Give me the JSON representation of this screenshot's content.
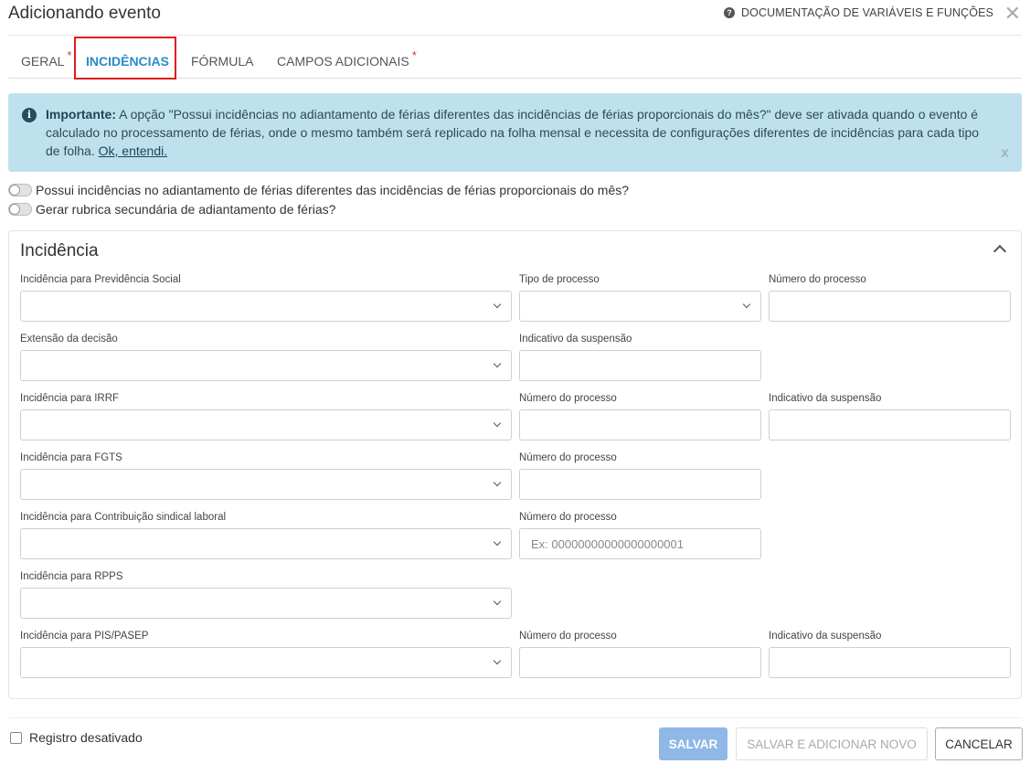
{
  "header": {
    "title": "Adicionando evento",
    "doc_link": "DOCUMENTAÇÃO DE VARIÁVEIS E FUNÇÕES",
    "close": "✕"
  },
  "tabs": [
    {
      "label": "GERAL",
      "required": "*"
    },
    {
      "label": "INCIDÊNCIAS",
      "required": ""
    },
    {
      "label": "FÓRMULA",
      "required": ""
    },
    {
      "label": "CAMPOS ADICIONAIS",
      "required": "*"
    }
  ],
  "active_tab": "INCIDÊNCIAS",
  "alert": {
    "icon": "i",
    "strong": "Importante:",
    "text": " A opção \"Possui incidências no adiantamento de férias diferentes das incidências de férias proporcionais do mês?\" deve ser ativada quando o evento é calculado no processamento de férias, onde o mesmo também será replicado na folha mensal e necessita de configurações diferentes de incidências para cada tipo de folha. ",
    "link": "Ok, entendi.",
    "dismiss": "x"
  },
  "toggles": [
    {
      "label": "Possui incidências no adiantamento de férias diferentes das incidências de férias proporcionais do mês?",
      "on": false
    },
    {
      "label": "Gerar rubrica secundária de adiantamento de férias?",
      "on": false
    }
  ],
  "panel": {
    "title": "Incidência",
    "fields": {
      "prev_social": {
        "label": "Incidência para Previdência Social",
        "value": ""
      },
      "tipo_processo": {
        "label": "Tipo de processo",
        "value": ""
      },
      "num_processo_1": {
        "label": "Número do processo",
        "value": ""
      },
      "extensao": {
        "label": "Extensão da decisão",
        "value": ""
      },
      "indicativo_1": {
        "label": "Indicativo da suspensão",
        "value": ""
      },
      "irrf": {
        "label": "Incidência para IRRF",
        "value": ""
      },
      "num_processo_2": {
        "label": "Número do processo",
        "value": ""
      },
      "indicativo_2": {
        "label": "Indicativo da suspensão",
        "value": ""
      },
      "fgts": {
        "label": "Incidência para FGTS",
        "value": ""
      },
      "num_processo_3": {
        "label": "Número do processo",
        "value": ""
      },
      "sindical": {
        "label": "Incidência para Contribuição sindical laboral",
        "value": ""
      },
      "num_processo_4": {
        "label": "Número do processo",
        "value": "",
        "placeholder": "Ex: 00000000000000000001"
      },
      "rpps": {
        "label": "Incidência para RPPS",
        "value": ""
      },
      "pis": {
        "label": "Incidência para PIS/PASEP",
        "value": ""
      },
      "num_processo_5": {
        "label": "Número do processo",
        "value": ""
      },
      "indicativo_3": {
        "label": "Indicativo da suspensão",
        "value": ""
      }
    }
  },
  "footer": {
    "checkbox_label": "Registro desativado",
    "checked": false,
    "save": "SALVAR",
    "save_new": "SALVAR E ADICIONAR NOVO",
    "cancel": "CANCELAR"
  }
}
